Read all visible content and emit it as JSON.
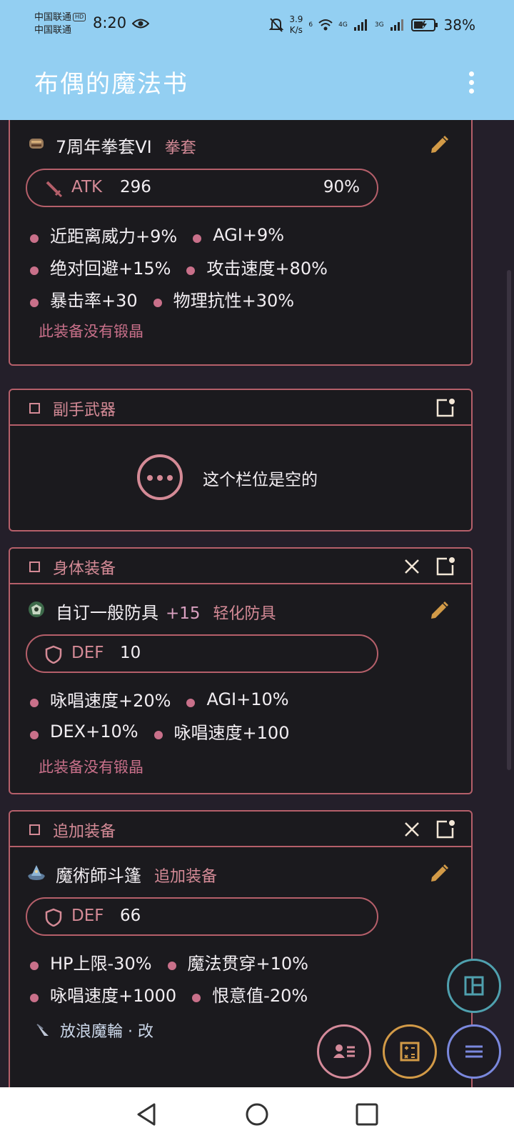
{
  "status_bar": {
    "carrier1": "中国联通",
    "carrier1_tag": "HD",
    "carrier2": "中国联通",
    "time": "8:20",
    "net_speed_value": "3.9",
    "net_speed_unit": "K/s",
    "network_6": "6",
    "network_4g": "4G",
    "network_3g": "3G",
    "battery": "38%"
  },
  "app_bar": {
    "title": "布偶的魔法书"
  },
  "weapon_card": {
    "item_name": "7周年拳套VI",
    "item_type": "拳套",
    "stat_name": "ATK",
    "stat_value": "296",
    "stat_pct": "90%",
    "effects": [
      [
        "近距离威力+9%",
        "AGI+9%"
      ],
      [
        "绝对回避+15%",
        "攻击速度+80%"
      ],
      [
        "暴击率+30",
        "物理抗性+30%"
      ]
    ],
    "no_crystal": "此装备没有锻晶"
  },
  "offhand_card": {
    "slot_title": "副手武器",
    "empty_text": "这个栏位是空的"
  },
  "armor_card": {
    "slot_title": "身体装备",
    "item_name": "自订一般防具",
    "item_refine": "+15",
    "item_type": "轻化防具",
    "stat_name": "DEF",
    "stat_value": "10",
    "effects": [
      [
        "咏唱速度+20%",
        "AGI+10%"
      ],
      [
        "DEX+10%",
        "咏唱速度+100"
      ]
    ],
    "no_crystal": "此装备没有锻晶"
  },
  "additional_card": {
    "slot_title": "追加装备",
    "item_name": "魔術師斗篷",
    "item_type": "追加装备",
    "stat_name": "DEF",
    "stat_value": "66",
    "effects": [
      [
        "HP上限-30%",
        "魔法贯穿+10%"
      ],
      [
        "咏唱速度+1000",
        "恨意值-20%"
      ]
    ],
    "crystal_name": "放浪魔輪 · 改"
  },
  "colors": {
    "app_bar": "#93cff2",
    "background": "#241f2a",
    "card_border": "#b55f6a",
    "accent_pink": "#d48a96",
    "pencil": "#d29a47",
    "fab_layout": "#4fa0ae",
    "fab_contact": "#d48a9a",
    "fab_calc": "#d29a47",
    "fab_menu": "#7a88dd"
  },
  "icons": {
    "fabs": [
      "layout-icon",
      "contact-list-icon",
      "calculator-icon",
      "menu-icon"
    ],
    "nav": [
      "back-icon",
      "home-icon",
      "recents-icon"
    ]
  }
}
